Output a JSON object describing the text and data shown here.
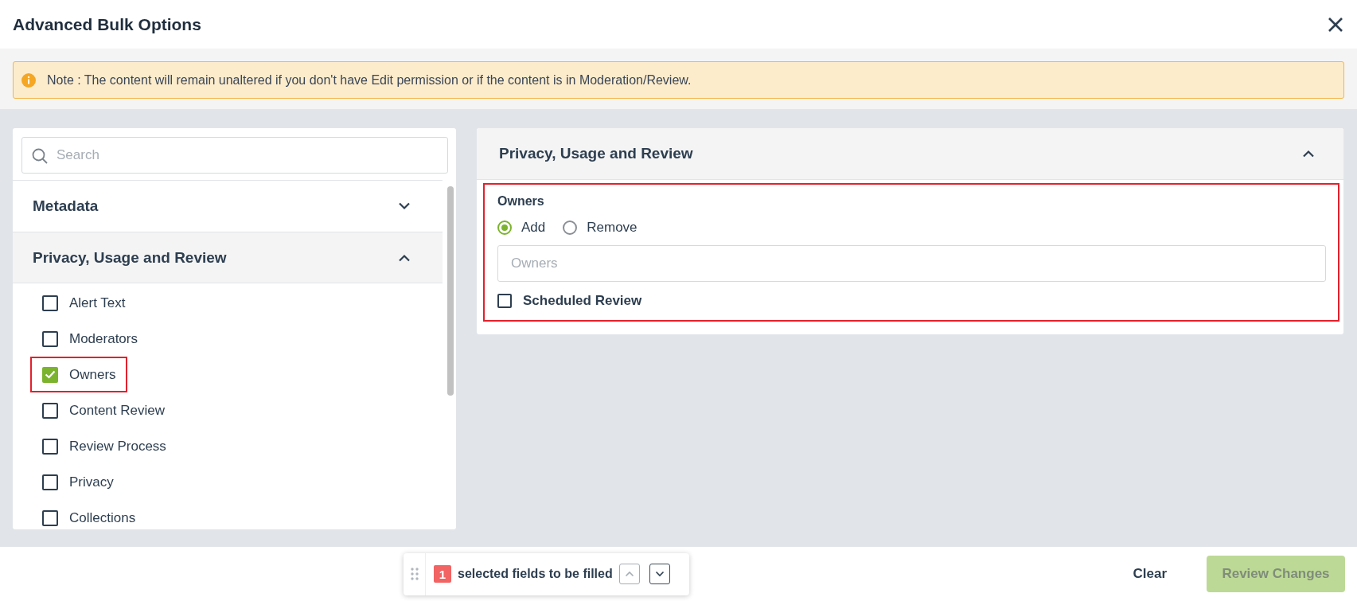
{
  "dialog": {
    "title": "Advanced Bulk Options"
  },
  "note": {
    "text": "Note : The content will remain unaltered if you don't have Edit permission or if the content is in Moderation/Review."
  },
  "left_panel": {
    "search": {
      "placeholder": "Search"
    },
    "sections": [
      {
        "title": "Metadata",
        "expanded": false
      },
      {
        "title": "Privacy, Usage and Review",
        "expanded": true,
        "items": [
          {
            "label": "Alert Text",
            "checked": false,
            "highlighted": false
          },
          {
            "label": "Moderators",
            "checked": false,
            "highlighted": false
          },
          {
            "label": "Owners",
            "checked": true,
            "highlighted": true
          },
          {
            "label": "Content Review",
            "checked": false,
            "highlighted": false
          },
          {
            "label": "Review Process",
            "checked": false,
            "highlighted": false
          },
          {
            "label": "Privacy",
            "checked": false,
            "highlighted": false
          },
          {
            "label": "Collections",
            "checked": false,
            "highlighted": false
          }
        ]
      }
    ]
  },
  "right_panel": {
    "title": "Privacy, Usage and Review",
    "expanded": true,
    "highlighted": true,
    "field_label": "Owners",
    "options": [
      {
        "label": "Add",
        "selected": true
      },
      {
        "label": "Remove",
        "selected": false
      }
    ],
    "owners_field": {
      "placeholder": "Owners"
    },
    "scheduled_review": {
      "label": "Scheduled Review",
      "checked": false
    }
  },
  "footer": {
    "count": "1",
    "count_text": "selected fields to be filled",
    "nav": [
      {
        "kind": "up",
        "disabled": true
      },
      {
        "kind": "down",
        "disabled": false
      }
    ],
    "clear": "Clear",
    "review": {
      "label": "Review Changes",
      "disabled": true
    }
  }
}
